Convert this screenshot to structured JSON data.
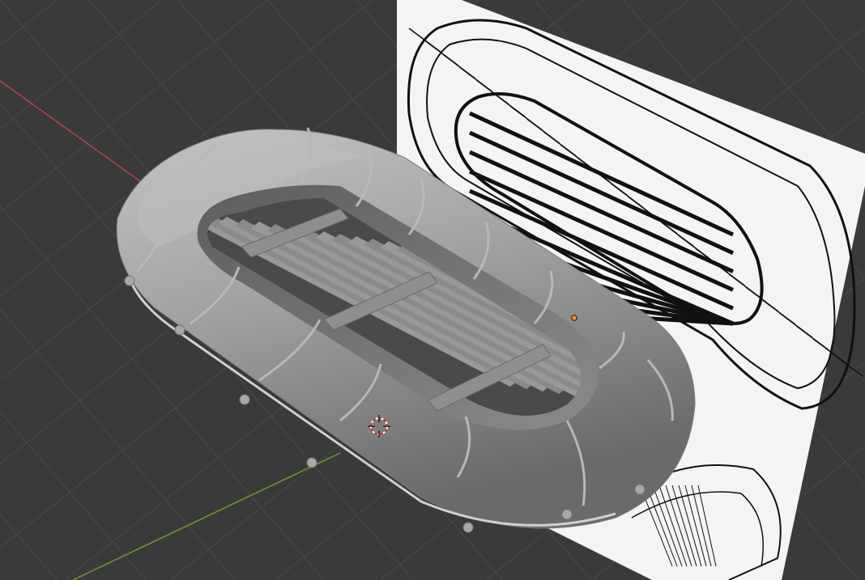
{
  "viewport": {
    "background": "#3a3a3a",
    "grid_color": "#4a4a4a",
    "x_axis_color": "#c0404c",
    "y_axis_color": "#6c9c30"
  },
  "reference_image": {
    "paper_color": "#f4f4f4",
    "ink_color": "#111111"
  },
  "model": {
    "shading_color": "#9a9a9a",
    "highlight_color": "#c8c8c8",
    "shadow_color": "#5a5a5a"
  },
  "markers": {
    "origin_color": "#ff9a1a",
    "cursor_color": "#d03030"
  }
}
